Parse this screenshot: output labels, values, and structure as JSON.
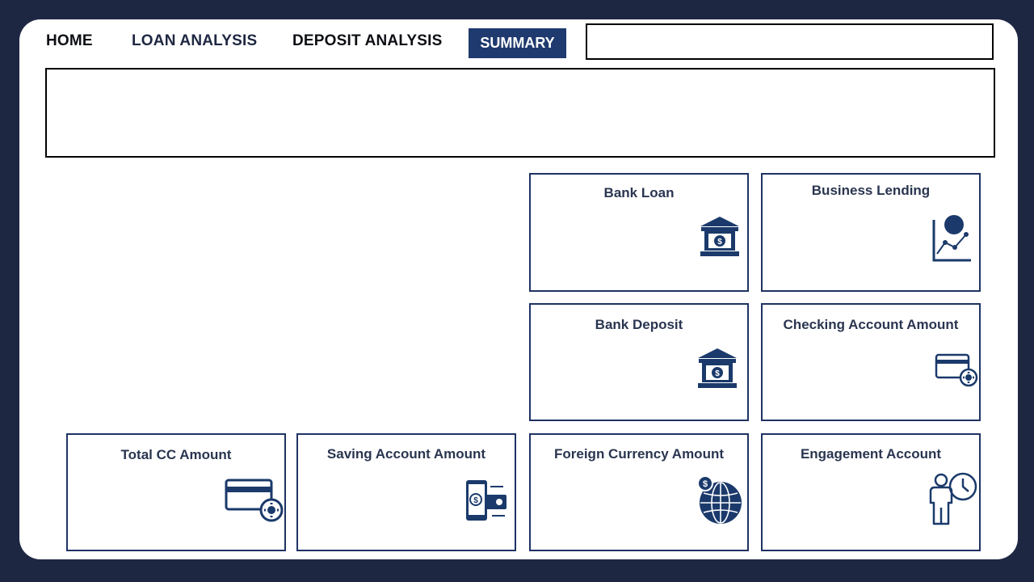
{
  "nav": {
    "home": "HOME",
    "loan_analysis": "LOAN ANALYSIS",
    "deposit_analysis": "DEPOSIT ANALYSIS",
    "summary": "SUMMARY",
    "active": "SUMMARY"
  },
  "colors": {
    "background": "#1e2742",
    "accent": "#1f3a6e",
    "card_border": "#1f3363",
    "icon": "#1b3a6b"
  },
  "cards": {
    "bank_loan": {
      "title": "Bank Loan",
      "icon": "bank-icon"
    },
    "business_lending": {
      "title": "Business Lending",
      "icon": "chart-icon"
    },
    "bank_deposit": {
      "title": "Bank Deposit",
      "icon": "bank-icon"
    },
    "checking_account_amount": {
      "title": "Checking Account Amount",
      "icon": "card-gear-icon"
    },
    "total_cc_amount": {
      "title": "Total CC Amount",
      "icon": "card-gear-icon"
    },
    "saving_account_amount": {
      "title": "Saving Account Amount",
      "icon": "mobile-payment-icon"
    },
    "foreign_currency_amount": {
      "title": "Foreign Currency Amount",
      "icon": "globe-dollar-icon"
    },
    "engagement_account": {
      "title": "Engagement Account",
      "icon": "person-clock-icon"
    }
  }
}
